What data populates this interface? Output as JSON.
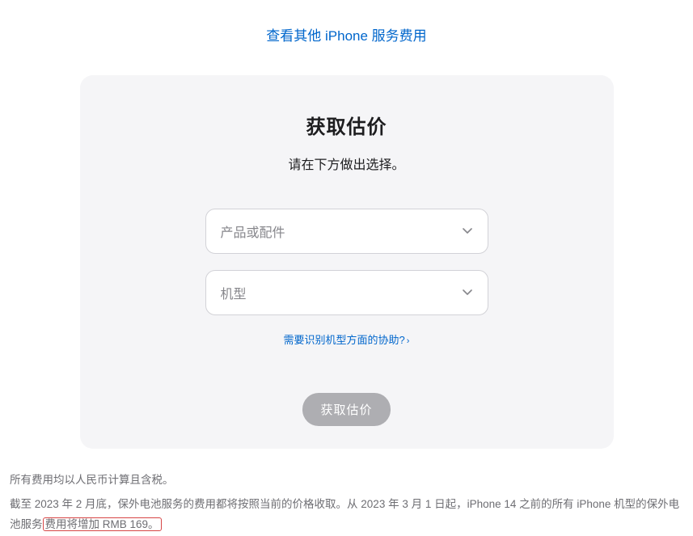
{
  "top_link": {
    "label": "查看其他 iPhone 服务费用"
  },
  "card": {
    "title": "获取估价",
    "subtitle": "请在下方做出选择。",
    "select_product_placeholder": "产品或配件",
    "select_model_placeholder": "机型",
    "help_label": "需要识别机型方面的协助?",
    "submit_label": "获取估价"
  },
  "footer": {
    "line1": "所有费用均以人民币计算且含税。",
    "line2_before": "截至 2023 年 2 月底，保外电池服务的费用都将按照当前的价格收取。从 2023 年 3 月 1 日起，iPhone 14 之前的所有 iPhone 机型的保外电池服务",
    "line2_highlight": "费用将增加 RMB 169。"
  }
}
